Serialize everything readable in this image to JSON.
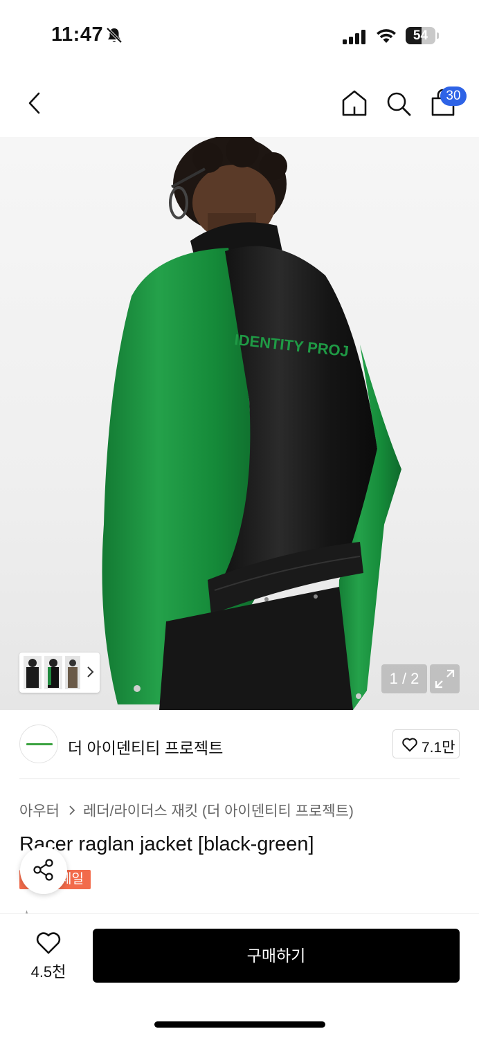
{
  "status_bar": {
    "time": "11:47",
    "battery_level": "54",
    "icons": [
      "bell-off-icon",
      "signal-icon",
      "wifi-icon",
      "battery-icon"
    ]
  },
  "nav": {
    "cart_count": "30",
    "icons": [
      "back-icon",
      "home-icon",
      "search-icon",
      "cart-icon"
    ],
    "badge_color": "#2e63e6"
  },
  "gallery": {
    "page_counter": "1 / 2",
    "garment_colors": [
      "#1f8a3e",
      "#141414"
    ],
    "chest_text": "IDENTITY PROJ"
  },
  "brand": {
    "name": "더 아이덴티티 프로젝트",
    "likes": "7.1만"
  },
  "breadcrumb": {
    "category": "아우터",
    "subcategory": "레더/라이더스 재킷 (더 아이덴티티 프로젝트)"
  },
  "product": {
    "title": "Racer raglan jacket [black-green]",
    "badge": "세일",
    "badge_color": "#f26b4b"
  },
  "bottom_bar": {
    "like_count": "4.5천",
    "buy_label": "구매하기"
  }
}
